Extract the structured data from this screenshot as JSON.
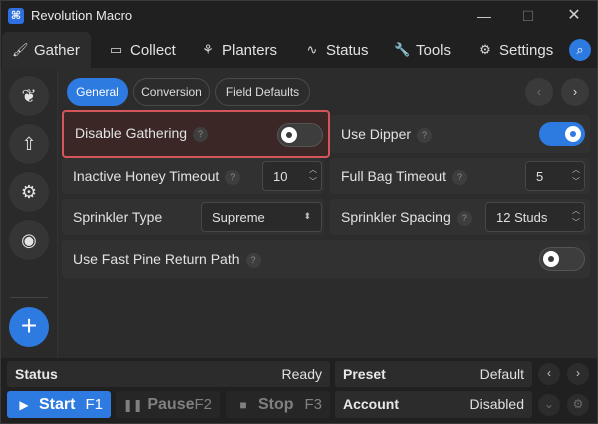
{
  "window": {
    "title": "Revolution Macro",
    "min": "—",
    "max": "☐",
    "close": "✕"
  },
  "tabs": [
    {
      "label": "Gather",
      "icon": "brush-icon"
    },
    {
      "label": "Collect",
      "icon": "ticket-icon"
    },
    {
      "label": "Planters",
      "icon": "plant-icon"
    },
    {
      "label": "Status",
      "icon": "pulse-icon"
    },
    {
      "label": "Tools",
      "icon": "wrench-icon"
    },
    {
      "label": "Settings",
      "icon": "gear-icon"
    }
  ],
  "subtabs": [
    "General",
    "Conversion",
    "Field Defaults"
  ],
  "settings": {
    "disable_gathering": {
      "label": "Disable Gathering",
      "on": false
    },
    "use_dipper": {
      "label": "Use Dipper",
      "on": true
    },
    "inactive_honey_timeout": {
      "label": "Inactive Honey Timeout",
      "value": "10"
    },
    "full_bag_timeout": {
      "label": "Full Bag Timeout",
      "value": "5"
    },
    "sprinkler_type": {
      "label": "Sprinkler Type",
      "value": "Supreme"
    },
    "sprinkler_spacing": {
      "label": "Sprinkler Spacing",
      "value": "12 Studs"
    },
    "fast_pine": {
      "label": "Use Fast Pine Return Path",
      "on": false
    }
  },
  "help_glyph": "?",
  "status": {
    "label": "Status",
    "value": "Ready"
  },
  "preset": {
    "label": "Preset",
    "value": "Default"
  },
  "account": {
    "label": "Account",
    "value": "Disabled"
  },
  "controls": {
    "start": {
      "label": "Start",
      "key": "F1"
    },
    "pause": {
      "label": "Pause",
      "key": "F2"
    },
    "stop": {
      "label": "Stop",
      "key": "F3"
    }
  },
  "colors": {
    "accent": "#2d7ae0",
    "highlight": "#d4555a",
    "background": "#202020"
  }
}
